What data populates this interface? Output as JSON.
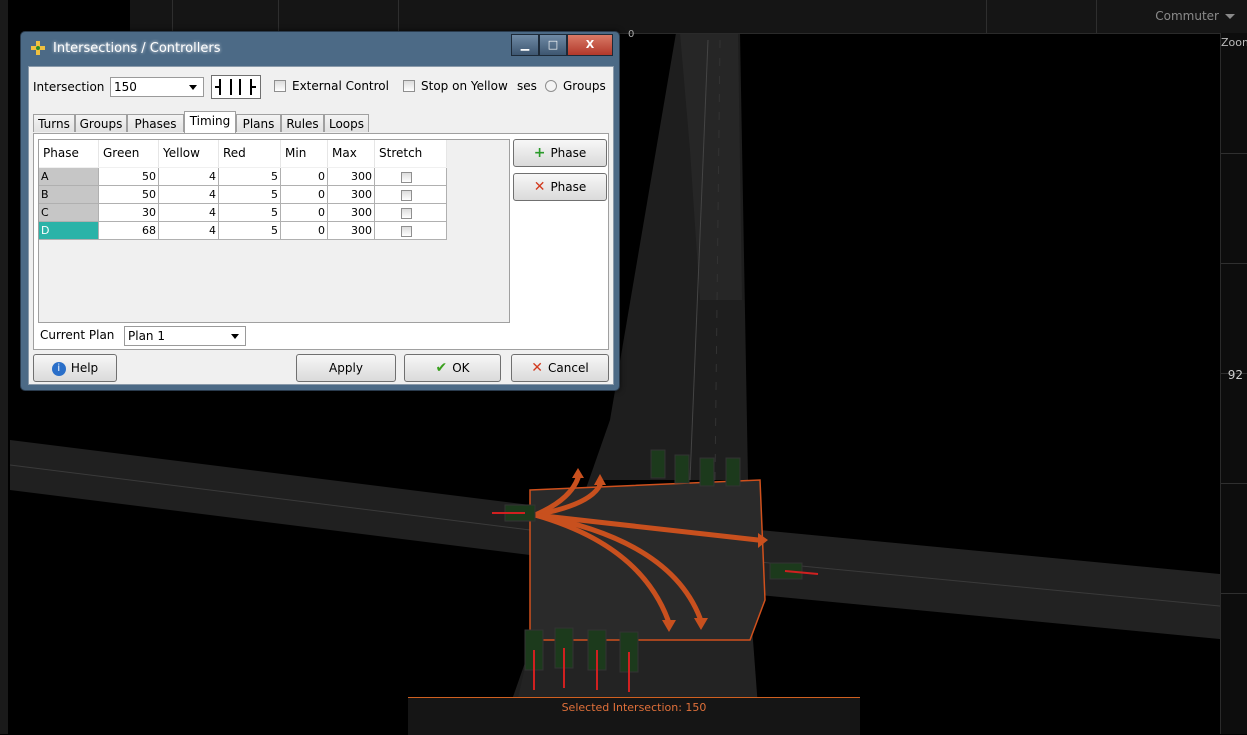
{
  "viewport": {
    "top_right_dropdown": "Commuter",
    "zoom_label": "Zoom",
    "scale_number": "92",
    "axis_zero": "0",
    "status_text": "Selected Intersection: 150"
  },
  "dialog": {
    "title": "Intersections / Controllers",
    "window_buttons": {
      "minimize": "▁",
      "maximize": "□",
      "close": "X"
    },
    "intersection_label": "Intersection",
    "intersection_value": "150",
    "external_control_label": "External Control",
    "stop_on_yellow_label": "Stop on Yellow",
    "phases_partial_label": "ses",
    "groups_radio_label": "Groups",
    "tabs": [
      "Turns",
      "Groups",
      "Phases",
      "Timing",
      "Plans",
      "Rules",
      "Loops"
    ],
    "active_tab": "Timing",
    "table": {
      "headers": [
        "Phase",
        "Green",
        "Yellow",
        "Red",
        "Min",
        "Max",
        "Stretch"
      ],
      "rows": [
        {
          "phase": "A",
          "green": "50",
          "yellow": "4",
          "red": "5",
          "min": "0",
          "max": "300",
          "stretch": false
        },
        {
          "phase": "B",
          "green": "50",
          "yellow": "4",
          "red": "5",
          "min": "0",
          "max": "300",
          "stretch": false
        },
        {
          "phase": "C",
          "green": "30",
          "yellow": "4",
          "red": "5",
          "min": "0",
          "max": "300",
          "stretch": false
        },
        {
          "phase": "D",
          "green": "68",
          "yellow": "4",
          "red": "5",
          "min": "0",
          "max": "300",
          "stretch": false
        }
      ],
      "selected_row": "D"
    },
    "add_phase_label": "Phase",
    "remove_phase_label": "Phase",
    "current_plan_label": "Current Plan",
    "current_plan_value": "Plan 1",
    "help_label": "Help",
    "apply_label": "Apply",
    "ok_label": "OK",
    "cancel_label": "Cancel"
  },
  "colors": {
    "accent_orange": "#d0501c",
    "selected_row": "#2bb3a8",
    "title_bar": "#4c6a86"
  }
}
